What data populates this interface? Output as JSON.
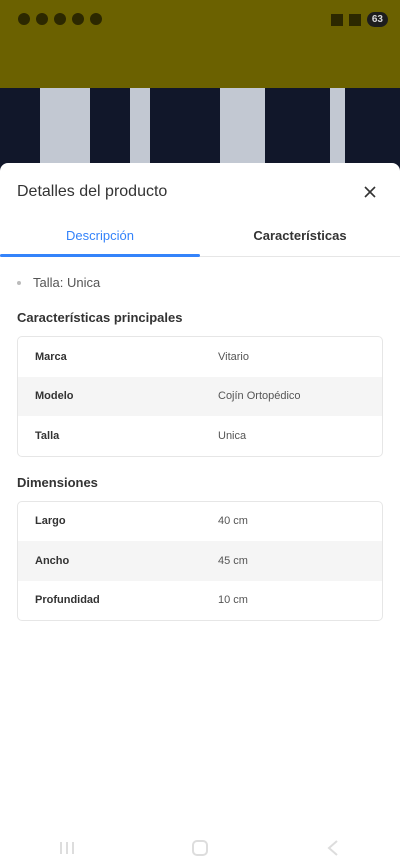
{
  "status_bar": {
    "battery": "63"
  },
  "sheet": {
    "title": "Detalles del producto",
    "tabs": [
      {
        "label": "Descripción",
        "active": true
      },
      {
        "label": "Características",
        "active": false
      }
    ],
    "bullet": "Talla: Unica",
    "main_features": {
      "title": "Características principales",
      "rows": [
        {
          "key": "Marca",
          "value": "Vitario"
        },
        {
          "key": "Modelo",
          "value": "Cojín Ortopédico"
        },
        {
          "key": "Talla",
          "value": "Unica"
        }
      ]
    },
    "dimensions": {
      "title": "Dimensiones",
      "rows": [
        {
          "key": "Largo",
          "value": "40 cm"
        },
        {
          "key": "Ancho",
          "value": "45 cm"
        },
        {
          "key": "Profundidad",
          "value": "10 cm"
        }
      ]
    }
  },
  "colors": {
    "accent": "#3483fa",
    "header_dimmed": "#6b6100"
  }
}
